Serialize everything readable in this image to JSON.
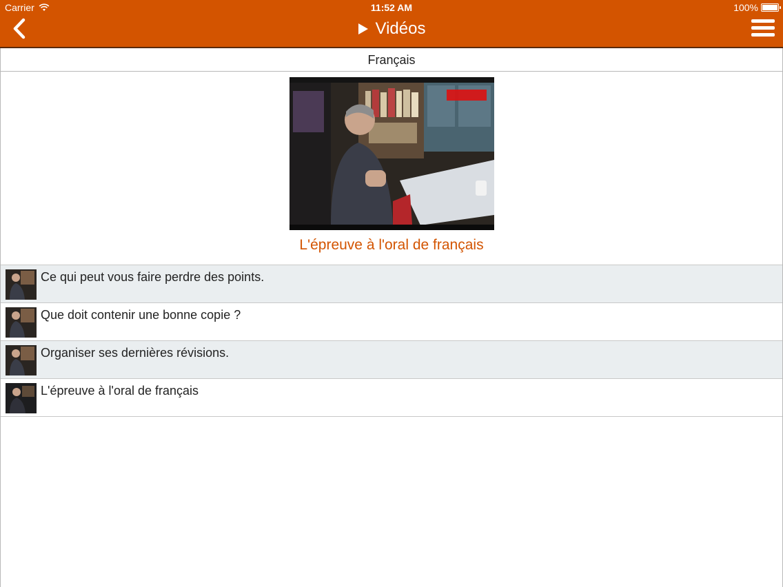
{
  "status_bar": {
    "carrier": "Carrier",
    "time": "11:52 AM",
    "battery": "100%"
  },
  "nav": {
    "title": "Vidéos",
    "back_icon": "chevron-left-icon",
    "menu_icon": "hamburger-menu-icon",
    "play_icon": "play-icon"
  },
  "section": {
    "title": "Français"
  },
  "featured": {
    "title": "L'épreuve à l'oral de français",
    "thumbnail": "video-thumbnail"
  },
  "videos": [
    {
      "title": "Ce qui peut vous faire perdre des points."
    },
    {
      "title": "Que doit contenir une bonne copie ?"
    },
    {
      "title": "Organiser ses dernières révisions."
    },
    {
      "title": "L'épreuve à l'oral de français"
    }
  ],
  "colors": {
    "accent": "#d35400",
    "row_alt": "#eaeef0"
  }
}
